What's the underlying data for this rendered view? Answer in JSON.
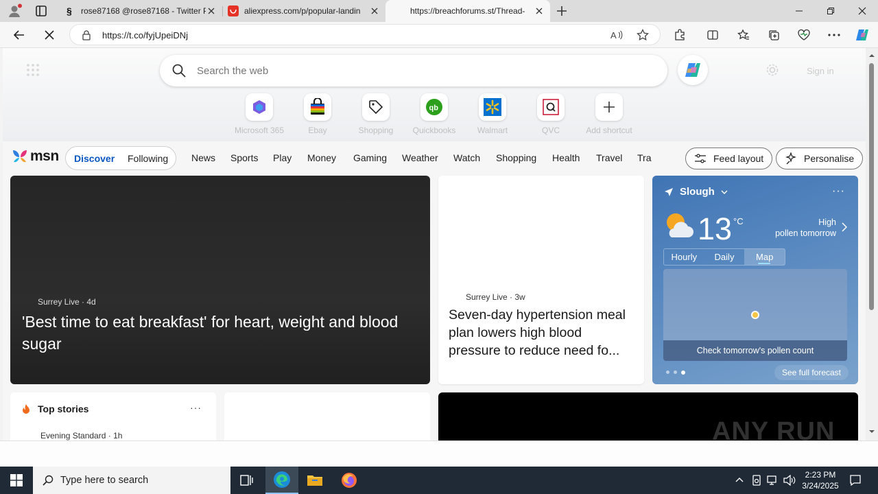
{
  "browser": {
    "tabs": [
      {
        "title": "rose87168 @rose87168 - Twitter P"
      },
      {
        "title": "aliexpress.com/p/popular-landin"
      },
      {
        "title": "https://breachforums.st/Thread-"
      }
    ],
    "url": "https://t.co/fyjUpeiDNj"
  },
  "msn": {
    "search_placeholder": "Search the web",
    "faint_signin": "Sign in",
    "shortcuts": [
      {
        "label": "Microsoft 365",
        "icon": "microsoft365-icon"
      },
      {
        "label": "Ebay",
        "icon": "ebay-bag-icon"
      },
      {
        "label": "Shopping",
        "icon": "tag-icon"
      },
      {
        "label": "Quickbooks",
        "icon": "quickbooks-icon"
      },
      {
        "label": "Walmart",
        "icon": "walmart-spark-icon"
      },
      {
        "label": "QVC",
        "icon": "qvc-icon"
      },
      {
        "label": "Add shortcut",
        "icon": "plus-icon"
      }
    ],
    "logo_text": "msn",
    "discover": "Discover",
    "following": "Following",
    "categories": [
      "News",
      "Sports",
      "Play",
      "Money",
      "Gaming",
      "Weather",
      "Watch",
      "Shopping",
      "Health",
      "Travel",
      "Tra"
    ],
    "feed_layout": "Feed layout",
    "personalise": "Personalise",
    "hero_card": {
      "source": "Surrey Live · 4d",
      "title": "'Best time to eat breakfast' for heart, weight and blood sugar"
    },
    "card2": {
      "source": "Surrey Live · 3w",
      "title": "Seven-day hypertension meal plan lowers high blood pressure to reduce need fo..."
    },
    "weather": {
      "location": "Slough",
      "temperature": "13",
      "unit": "°C",
      "pollen_line1": "High",
      "pollen_line2": "pollen tomorrow",
      "tabs": [
        "Hourly",
        "Daily",
        "Map"
      ],
      "active_tab": "Map",
      "map_caption": "Check tomorrow's pollen count",
      "see_forecast": "See full forecast"
    },
    "top_stories": {
      "title": "Top stories",
      "source": "Evening Standard · 1h"
    }
  },
  "watermark": "ANY RUN",
  "taskbar": {
    "search_placeholder": "Type here to search",
    "time": "2:23 PM",
    "date": "3/24/2025"
  },
  "colors": {
    "accent": "#0a56c2",
    "taskbar": "#1f2a36",
    "weather": "#4a7cb8"
  }
}
